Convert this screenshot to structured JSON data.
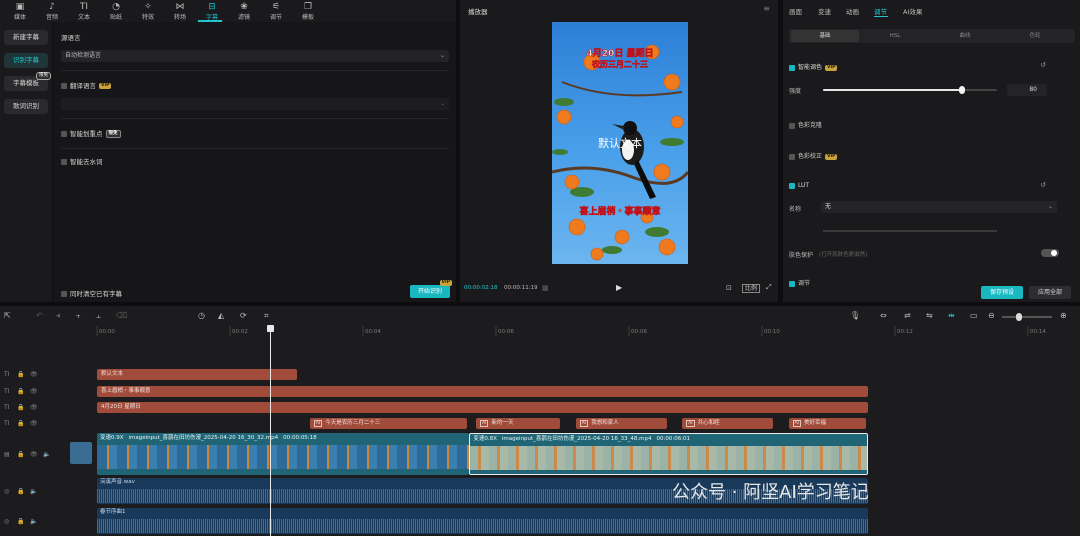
{
  "toolbar": {
    "items": [
      {
        "label": "媒体",
        "icon": "media-icon"
      },
      {
        "label": "音频",
        "icon": "audio-icon"
      },
      {
        "label": "文本",
        "icon": "text-icon"
      },
      {
        "label": "贴纸",
        "icon": "sticker-icon"
      },
      {
        "label": "特效",
        "icon": "effects-icon"
      },
      {
        "label": "转场",
        "icon": "transition-icon"
      },
      {
        "label": "字幕",
        "icon": "subtitle-icon",
        "active": true
      },
      {
        "label": "滤镜",
        "icon": "filter-icon"
      },
      {
        "label": "调节",
        "icon": "adjust-icon"
      },
      {
        "label": "模板",
        "icon": "template-icon"
      }
    ]
  },
  "left_menu": {
    "items": [
      "新建字幕",
      "识别字幕",
      "字幕模板",
      "歌词识别"
    ],
    "template_badge": "限免"
  },
  "subtitle_panel": {
    "source_lang_label": "源语言",
    "source_lang_value": "自动检测语言",
    "translate_label": "翻译语言",
    "vip": "VIP",
    "smart_highlight_label": "智能划重点",
    "smart_highlight_badge": "限免",
    "smart_filler_label": "智能去水词",
    "clear_existing_label": "同时清空已有字幕",
    "start_button": "开始识别"
  },
  "player": {
    "title": "播放器",
    "overlay_date": "4月20日 星期日",
    "overlay_lunar": "农历三月二十三",
    "overlay_default": "默认文本",
    "overlay_bottom": "喜上眉梢・事事顺意",
    "time_current": "00:00:02:18",
    "time_total": "00:00:11:19",
    "ratio_label": "比例"
  },
  "right_panel": {
    "tabs": [
      "画面",
      "变速",
      "动画",
      "调节",
      "AI效果"
    ],
    "active_tab": "调节",
    "subtabs": [
      "基础",
      "HSL",
      "曲线",
      "色轮"
    ],
    "smart_color_label": "智能调色",
    "strength_label": "强度",
    "strength_value": "80",
    "strength_fraction": 0.8,
    "color_match_label": "色彩克隆",
    "color_correct_label": "色彩校正",
    "lut_label": "LUT",
    "name_label": "名称",
    "name_value": "无",
    "skin_label": "肤色保护",
    "skin_hint": "(打开就肤色更滋然)",
    "adjust_label": "调节",
    "save_preset": "保存预设",
    "apply_all": "应用全部",
    "accent": "#19b7c0"
  },
  "timeline": {
    "ruler": [
      "00:00",
      "00:02",
      "00:04",
      "00:06",
      "00:08",
      "00:10",
      "00:12",
      "00:14"
    ],
    "text_tracks": [
      [
        {
          "label": "默认文本",
          "start": 0.0,
          "end": 3.0
        }
      ],
      [
        {
          "label": "喜上眉梢・事事顺意",
          "start": 0.0,
          "end": 11.6
        }
      ],
      [
        {
          "label": "4月20日 星期日",
          "start": 0.0,
          "end": 11.6
        }
      ]
    ],
    "caption_track": [
      {
        "label": "今天是农历三月二十三",
        "start": 3.2,
        "end": 5.6
      },
      {
        "label": "新的一天",
        "start": 5.7,
        "end": 7.0
      },
      {
        "label": "我想和家人",
        "start": 7.2,
        "end": 8.6
      },
      {
        "label": "共心和睦",
        "start": 8.8,
        "end": 10.2
      },
      {
        "label": "美好幸福",
        "start": 10.4,
        "end": 11.6
      }
    ],
    "ai_tag": "AI",
    "video_clips": [
      {
        "speed": "变速0.9X",
        "name": "imageinput_喜鹊在田坊伤漫_2025-04-20 16_30_32.mp4",
        "duration": "00:00:05:18",
        "start": 0.0,
        "end": 5.6
      },
      {
        "speed": "变速0.8X",
        "name": "imageinput_喜鹊在田坊伤漫_2025-04-20 16_33_48.mp4",
        "duration": "00:00:06:01",
        "start": 5.6,
        "end": 11.6
      }
    ],
    "audio_clips": [
      {
        "label": "浣溪声音.wav",
        "start": 0.0,
        "end": 11.6
      },
      {
        "label": "春节序曲1",
        "start": 0.0,
        "end": 11.6
      }
    ],
    "playhead_time": 2.6
  },
  "watermark": "公众号 · 阿坚AI学习笔记"
}
